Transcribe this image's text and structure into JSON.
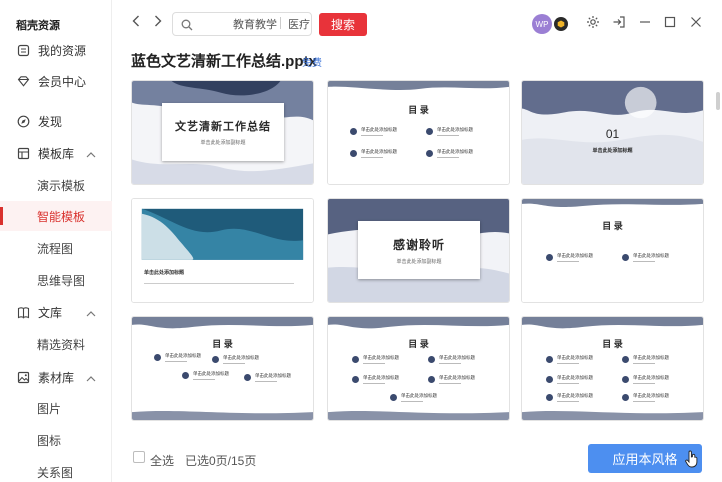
{
  "app": {
    "title": "稻壳资源"
  },
  "sidebar": {
    "items": [
      {
        "label": "我的资源",
        "icon": "resource-icon"
      },
      {
        "label": "会员中心",
        "icon": "diamond-icon"
      },
      {
        "label": "发现",
        "icon": "compass-icon"
      },
      {
        "label": "模板库",
        "icon": "template-icon",
        "expandable": true
      },
      {
        "label": "演示模板",
        "sub": true
      },
      {
        "label": "智能模板",
        "sub": true,
        "active": true
      },
      {
        "label": "流程图",
        "sub": true
      },
      {
        "label": "思维导图",
        "sub": true
      },
      {
        "label": "文库",
        "icon": "book-icon",
        "expandable": true
      },
      {
        "label": "精选资料",
        "sub": true
      },
      {
        "label": "素材库",
        "icon": "image-icon",
        "expandable": true
      },
      {
        "label": "图片",
        "sub": true
      },
      {
        "label": "图标",
        "sub": true
      },
      {
        "label": "关系图",
        "sub": true
      }
    ]
  },
  "topbar": {
    "search_placeholder": "",
    "tags": [
      "教育教学",
      "医疗"
    ],
    "search_button": "搜索",
    "avatar_text": "WP"
  },
  "document": {
    "title": "蓝色文艺清新工作总结.pptx",
    "badge": "免费"
  },
  "thumbnails": [
    {
      "type": "cover",
      "title": "文艺清新工作总结",
      "subtitle": "单击此处添加副标题"
    },
    {
      "type": "toc",
      "heading": "目 录",
      "item_label": "单击此处添加标题"
    },
    {
      "type": "section",
      "number": "01",
      "label": "单击此处添加标题"
    },
    {
      "type": "photo",
      "label": "单击此处添加标题"
    },
    {
      "type": "thanks",
      "title": "感谢聆听",
      "subtitle": "单击此处添加副标题"
    },
    {
      "type": "toc",
      "heading": "目 录",
      "item_label": "单击此处添加标题"
    },
    {
      "type": "toc",
      "heading": "目 录",
      "item_label": "单击此处添加标题"
    },
    {
      "type": "toc",
      "heading": "目 录",
      "item_label": "单击此处添加标题"
    },
    {
      "type": "toc",
      "heading": "目 录",
      "item_label": "单击此处添加标题"
    }
  ],
  "footer": {
    "select_all": "全选",
    "selected_count": "已选0页/15页",
    "apply_button": "应用本风格"
  },
  "colors": {
    "accent_red": "#e8333a",
    "apply_blue": "#4d8ff0",
    "free_blue": "#3a72d8",
    "ink_navy": "#2f3d63"
  }
}
